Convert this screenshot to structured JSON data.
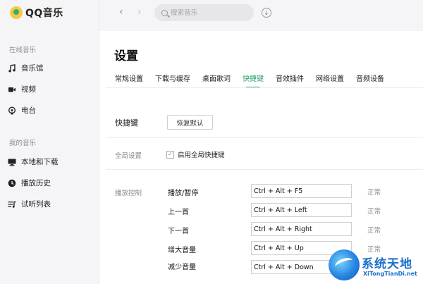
{
  "app": {
    "logo_text": "QQ音乐"
  },
  "sidebar": {
    "online_title": "在线音乐",
    "online_items": [
      {
        "label": "音乐馆",
        "icon": "music-note-icon"
      },
      {
        "label": "视频",
        "icon": "video-icon"
      },
      {
        "label": "电台",
        "icon": "radio-icon"
      }
    ],
    "my_title": "我的音乐",
    "my_items": [
      {
        "label": "本地和下载",
        "icon": "monitor-icon"
      },
      {
        "label": "播放历史",
        "icon": "clock-icon"
      },
      {
        "label": "试听列表",
        "icon": "playlist-icon"
      }
    ]
  },
  "topbar": {
    "search_placeholder": "搜索音乐"
  },
  "page": {
    "title": "设置",
    "tabs": [
      "常规设置",
      "下载与缓存",
      "桌面歌词",
      "快捷键",
      "音效插件",
      "网络设置",
      "音频设备"
    ],
    "active_tab": "快捷键"
  },
  "shortcuts": {
    "section_label": "快捷键",
    "reset_label": "恢复默认",
    "global_label": "全局设置",
    "global_checkbox_label": "启用全局快捷键",
    "global_checked": true,
    "play_control_label": "播放控制",
    "rows": [
      {
        "label": "播放/暂停",
        "key": "Ctrl + Alt + F5",
        "status": "正常"
      },
      {
        "label": "上一首",
        "key": "Ctrl + Alt + Left",
        "status": "正常"
      },
      {
        "label": "下一首",
        "key": "Ctrl + Alt + Right",
        "status": "正常"
      },
      {
        "label": "增大音量",
        "key": "Ctrl + Alt + Up",
        "status": "正常"
      },
      {
        "label": "减少音量",
        "key": "Ctrl + Alt + Down",
        "status": ""
      }
    ]
  },
  "watermark": {
    "title": "系统天地",
    "url": "XiTongTianDi.net"
  },
  "colors": {
    "accent": "#31c27c",
    "sidebar_bg": "#f5f5f7"
  }
}
